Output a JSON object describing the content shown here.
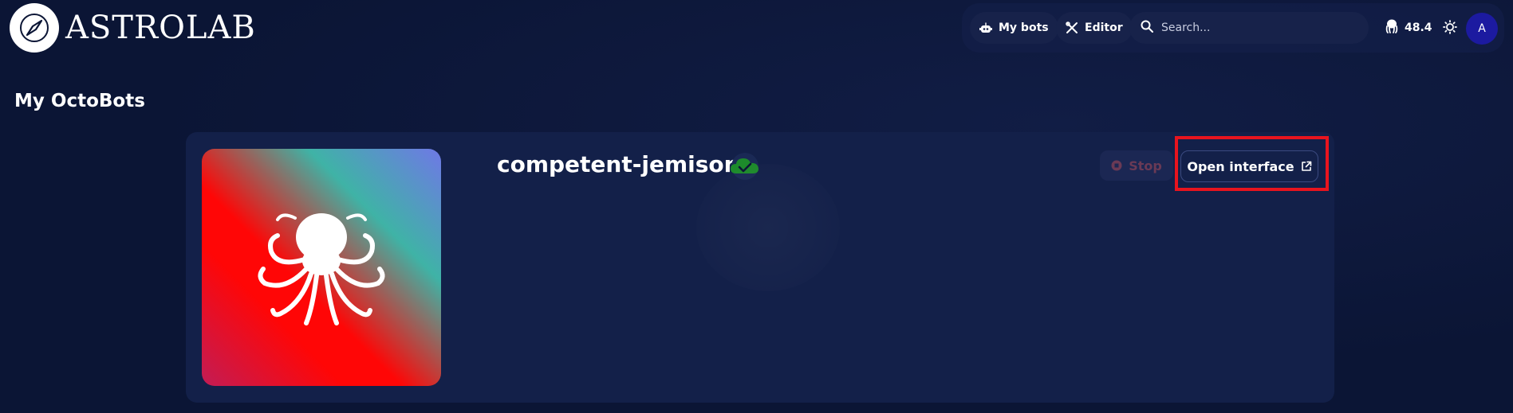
{
  "brand": {
    "name": "ASTROLAB",
    "logo_icon": "compass-icon"
  },
  "nav": {
    "my_bots_label": "My bots",
    "editor_label": "Editor",
    "search_placeholder": "Search...",
    "credits_value": "48.4",
    "avatar_initial": "A"
  },
  "page": {
    "title": "My OctoBots"
  },
  "bot": {
    "name": "competent-jemison",
    "status_icon": "cloud-check-icon",
    "status_color": "#1d8a2b",
    "stop_label": "Stop",
    "open_label": "Open interface"
  },
  "colors": {
    "background": "#0b1535",
    "card": "#132049",
    "avatar": "#1c1aa0",
    "highlight": "#e8141e"
  }
}
